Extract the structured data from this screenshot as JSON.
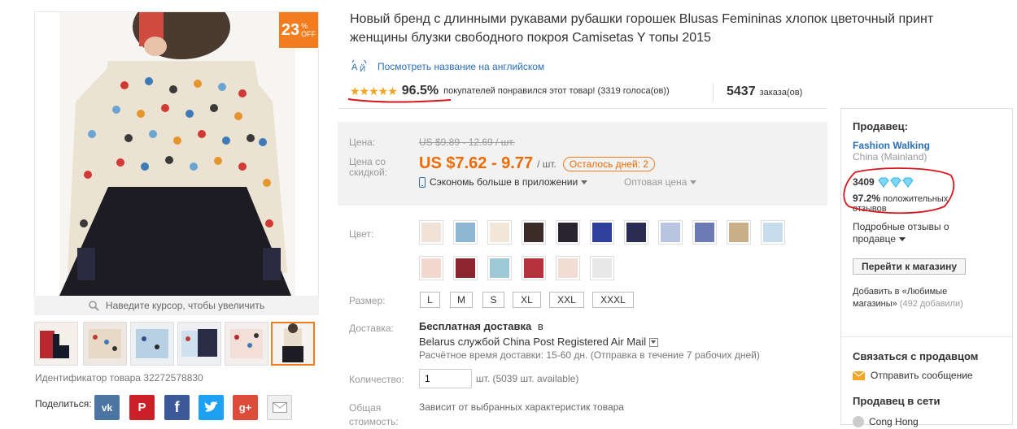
{
  "gallery": {
    "discount_num": "23",
    "discount_pct": "%",
    "discount_off": "OFF",
    "zoom_hint": "Наведите курсор, чтобы увеличить",
    "product_id_label": "Идентификатор товара 32272578830",
    "share_label": "Поделиться:",
    "share_buttons": [
      {
        "name": "vk",
        "glyph": "vk",
        "color": "#4c75a3"
      },
      {
        "name": "pinterest",
        "glyph": "P",
        "color": "#cb2027"
      },
      {
        "name": "facebook",
        "glyph": "f",
        "color": "#3b5998"
      },
      {
        "name": "twitter",
        "glyph": "t",
        "color": "#1da1f2"
      },
      {
        "name": "googleplus",
        "glyph": "g+",
        "color": "#dd4b39"
      },
      {
        "name": "email",
        "glyph": "✉",
        "color": "#cfcfcf"
      }
    ]
  },
  "product": {
    "title_line1": "Новый бренд с длинными рукавами рубашки горошек Blusas Femininas хлопок цветочный принт",
    "title_line2": "женщины блузки свободного покроя Camisetas Y топы 2015",
    "translate_link": "Посмотреть название на английском",
    "rating_percent": "96.5%",
    "rating_text": "покупателей понравился этот товар! (3319 голоса(ов))",
    "orders_count": "5437",
    "orders_label": "заказа(ов)",
    "star_count": 5
  },
  "price": {
    "price_label": "Цена:",
    "old_price": "US $9.89 - 12.69 / шт.",
    "discount_label_1": "Цена со",
    "discount_label_2": "скидкой:",
    "new_price": "US $7.62 - 9.77",
    "unit": "/ шт.",
    "countdown": "Осталось дней: 2",
    "app_savings": "Сэкономь больше в приложении",
    "wholesale": "Оптовая цена"
  },
  "options": {
    "color_label": "Цвет:",
    "color_swatches": [
      {
        "color": "#f0e2d6"
      },
      {
        "color": "#8fb7d3"
      },
      {
        "color": "#f1e6d8"
      },
      {
        "color": "#3b2c28"
      },
      {
        "color": "#2a2430"
      },
      {
        "color": "#2f3f9c"
      },
      {
        "color": "#2b2d55"
      },
      {
        "color": "#b9c4e0"
      },
      {
        "color": "#6d7bb5"
      },
      {
        "color": "#c9b089"
      },
      {
        "color": "#c7dcec"
      },
      {
        "color": "#f3d8d0"
      },
      {
        "color": "#8b2630"
      },
      {
        "color": "#9fc8d6"
      },
      {
        "color": "#b5343b"
      },
      {
        "color": "#f1ddd4"
      },
      {
        "color": "#e8e8e8"
      }
    ],
    "size_label": "Размер:",
    "sizes": [
      "L",
      "M",
      "S",
      "XL",
      "XXL",
      "XXXL"
    ],
    "shipping_label": "Доставка:",
    "shipping_free": "Бесплатная доставка",
    "shipping_in": "в",
    "shipping_dest": "Belarus службой China Post Registered Air Mail",
    "shipping_time": "Расчётное время доставки: 15-60 дн. (Отправка в течение 7 рабочих дней)",
    "qty_label": "Количество:",
    "qty_value": "1",
    "qty_available": "шт. (5039 шт. available)",
    "total_label_1": "Общая",
    "total_label_2": "стоимость:",
    "total_value": "Зависит от выбранных характеристик товара"
  },
  "seller": {
    "heading": "Продавец:",
    "store_name": "Fashion Walking",
    "location": "China (Mainland)",
    "score": "3409",
    "positive_pct": "97.2%",
    "positive_label_1": "положительных",
    "positive_label_2": "отзывов",
    "reviews_link_1": "Подробные отзывы о",
    "reviews_link_2": "продавце",
    "go_to_store": "Перейти к магазину",
    "favorites_1": "Добавить в «Любимые",
    "favorites_2": "магазины»",
    "favorites_count": "(492 добавили)",
    "contact_heading": "Связаться с продавцом",
    "send_message": "Отправить сообщение",
    "online_heading": "Продавец в сети",
    "online_person": "Cong Hong"
  },
  "colors": {
    "accent": "#f37c1e",
    "price_orange": "#f06a00",
    "link_blue": "#2a6fb8",
    "annotation_red": "#d8141c",
    "diamond": "#2fb3e5",
    "star": "#f7a21b"
  }
}
